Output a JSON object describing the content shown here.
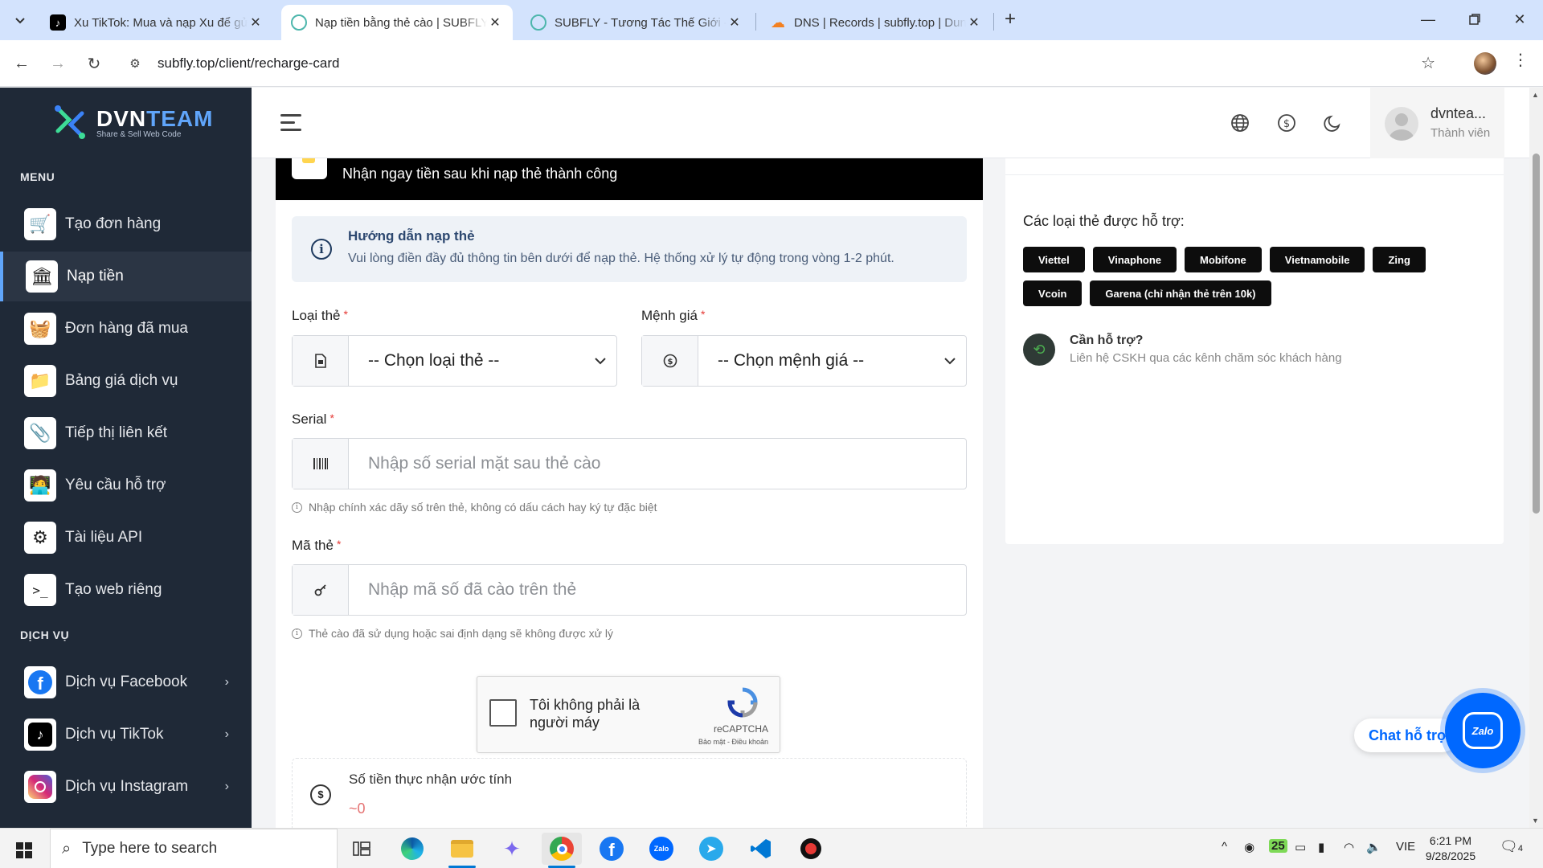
{
  "browser": {
    "tabs": [
      {
        "title": "Xu TikTok: Mua và nạp Xu để gửi",
        "icon": "tiktok-icon"
      },
      {
        "title": "Nạp tiền bằng thẻ cào | SUBFLY",
        "icon": "subfly-icon",
        "active": true
      },
      {
        "title": "SUBFLY - Tương Tác Thế Giới - D",
        "icon": "subfly-icon"
      },
      {
        "title": "DNS | Records | subfly.top | Dun",
        "icon": "cloudflare-icon"
      }
    ],
    "url": "subfly.top/client/recharge-card"
  },
  "sidebar": {
    "logo_main": "DVN",
    "logo_accent": "TEAM",
    "logo_tagline": "Share & Sell Web Code",
    "menu_label": "MENU",
    "items": [
      {
        "label": "Tạo đơn hàng",
        "icon": "cart-icon"
      },
      {
        "label": "Nạp tiền",
        "icon": "bank-icon",
        "active": true
      },
      {
        "label": "Đơn hàng đã mua",
        "icon": "basket-icon"
      },
      {
        "label": "Bảng giá dịch vụ",
        "icon": "folder-icon"
      },
      {
        "label": "Tiếp thị liên kết",
        "icon": "paperclip-icon"
      },
      {
        "label": "Yêu cầu hỗ trợ",
        "icon": "support-icon"
      },
      {
        "label": "Tài liệu API",
        "icon": "openai-icon"
      },
      {
        "label": "Tạo web riêng",
        "icon": "terminal-icon"
      }
    ],
    "services_label": "DỊCH VỤ",
    "services": [
      {
        "label": "Dịch vụ Facebook",
        "icon": "facebook-icon"
      },
      {
        "label": "Dịch vụ TikTok",
        "icon": "tiktok-icon"
      },
      {
        "label": "Dịch vụ Instagram",
        "icon": "instagram-icon"
      }
    ]
  },
  "header": {
    "user_name": "dvntea...",
    "user_role": "Thành viên"
  },
  "form": {
    "banner_text": "Nhận ngay tiền sau khi nạp thẻ thành công",
    "guide_title": "Hướng dẫn nạp thẻ",
    "guide_desc": "Vui lòng điền đầy đủ thông tin bên dưới để nạp thẻ. Hệ thống xử lý tự động trong vòng 1-2 phút.",
    "card_type_label": "Loại thẻ",
    "card_type_value": "-- Chọn loại thẻ --",
    "amount_label": "Mệnh giá",
    "amount_value": "-- Chọn mệnh giá --",
    "serial_label": "Serial",
    "serial_placeholder": "Nhập số serial mặt sau thẻ cào",
    "serial_hint": "Nhập chính xác dãy số trên thẻ, không có dấu cách hay ký tự đặc biệt",
    "code_label": "Mã thẻ",
    "code_placeholder": "Nhập mã số đã cào trên thẻ",
    "code_hint": "Thẻ cào đã sử dụng hoặc sai định dạng sẽ không được xử lý",
    "required_mark": "*",
    "captcha_label": "Tôi không phải là người máy",
    "captcha_brand": "reCAPTCHA",
    "captcha_terms": "Bảo mật - Điều khoản",
    "estimate_label": "Số tiền thực nhận ước tính",
    "estimate_value": "~0"
  },
  "supported": {
    "title": "Các loại thẻ được hỗ trợ:",
    "cards": [
      "Viettel",
      "Vinaphone",
      "Mobifone",
      "Vietnamobile",
      "Zing",
      "Vcoin",
      "Garena (chỉ nhận thẻ trên 10k)"
    ],
    "help_title": "Cần hỗ trợ?",
    "help_desc": "Liên hệ CSKH qua các kênh chăm sóc khách hàng"
  },
  "chat": {
    "label": "Chat hỗ trợ",
    "bubble": "Zalo"
  },
  "taskbar": {
    "search_placeholder": "Type here to search",
    "tray_badge": "25",
    "lang": "VIE",
    "time": "6:21 PM",
    "date": "9/28/2025",
    "notif_count": "4"
  }
}
